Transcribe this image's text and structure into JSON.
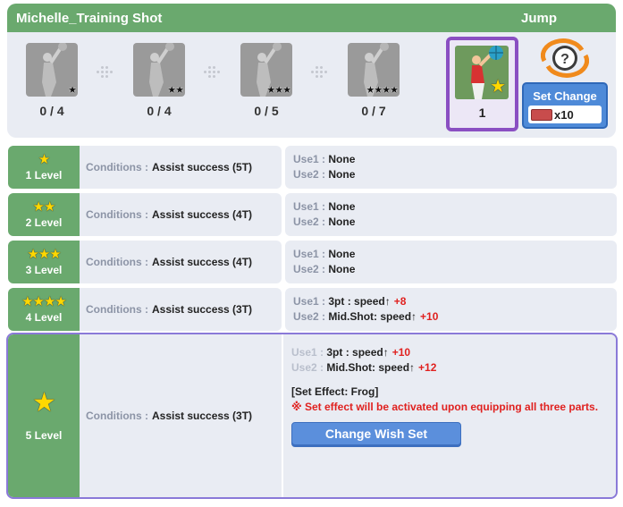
{
  "header": {
    "title": "Michelle_Training Shot",
    "tag": "Jump"
  },
  "cards": [
    {
      "stars": "★",
      "count": "0 / 4"
    },
    {
      "stars": "★★",
      "count": "0 / 4"
    },
    {
      "stars": "★★★",
      "count": "0 / 5"
    },
    {
      "stars": "★★★★",
      "count": "0 / 7"
    }
  ],
  "active_card": {
    "stars": "★",
    "count": "1"
  },
  "set_change": {
    "label": "Set Change",
    "cost": "x10"
  },
  "levels": [
    {
      "stars": "★",
      "level": "1 Level",
      "cond_label": "Conditions :",
      "cond_value": "Assist success (5T)",
      "use1_label": "Use1 :",
      "use1_value": "None",
      "use1_plus": "",
      "use2_label": "Use2 :",
      "use2_value": "None",
      "use2_plus": ""
    },
    {
      "stars": "★★",
      "level": "2 Level",
      "cond_label": "Conditions :",
      "cond_value": "Assist success (4T)",
      "use1_label": "Use1 :",
      "use1_value": "None",
      "use1_plus": "",
      "use2_label": "Use2 :",
      "use2_value": "None",
      "use2_plus": ""
    },
    {
      "stars": "★★★",
      "level": "3 Level",
      "cond_label": "Conditions :",
      "cond_value": "Assist success (4T)",
      "use1_label": "Use1 :",
      "use1_value": "None",
      "use1_plus": "",
      "use2_label": "Use2 :",
      "use2_value": "None",
      "use2_plus": ""
    },
    {
      "stars": "★★★★",
      "level": "4 Level",
      "cond_label": "Conditions :",
      "cond_value": "Assist success (3T)",
      "use1_label": "Use1 :",
      "use1_value": "3pt : speed↑",
      "use1_plus": "+8",
      "use2_label": "Use2 :",
      "use2_value": "Mid.Shot: speed↑",
      "use2_plus": "+10"
    }
  ],
  "level5": {
    "stars": "★",
    "level": "5 Level",
    "cond_label": "Conditions :",
    "cond_value": "Assist success (3T)",
    "use1_label": "Use1 :",
    "use1_value": "3pt : speed↑",
    "use1_plus": "+10",
    "use2_label": "Use2 :",
    "use2_value": "Mid.Shot: speed↑",
    "use2_plus": "+12",
    "set_effect": "[Set Effect: Frog]",
    "warning": "※ Set effect will be activated upon equipping all three parts.",
    "button": "Change Wish Set"
  }
}
